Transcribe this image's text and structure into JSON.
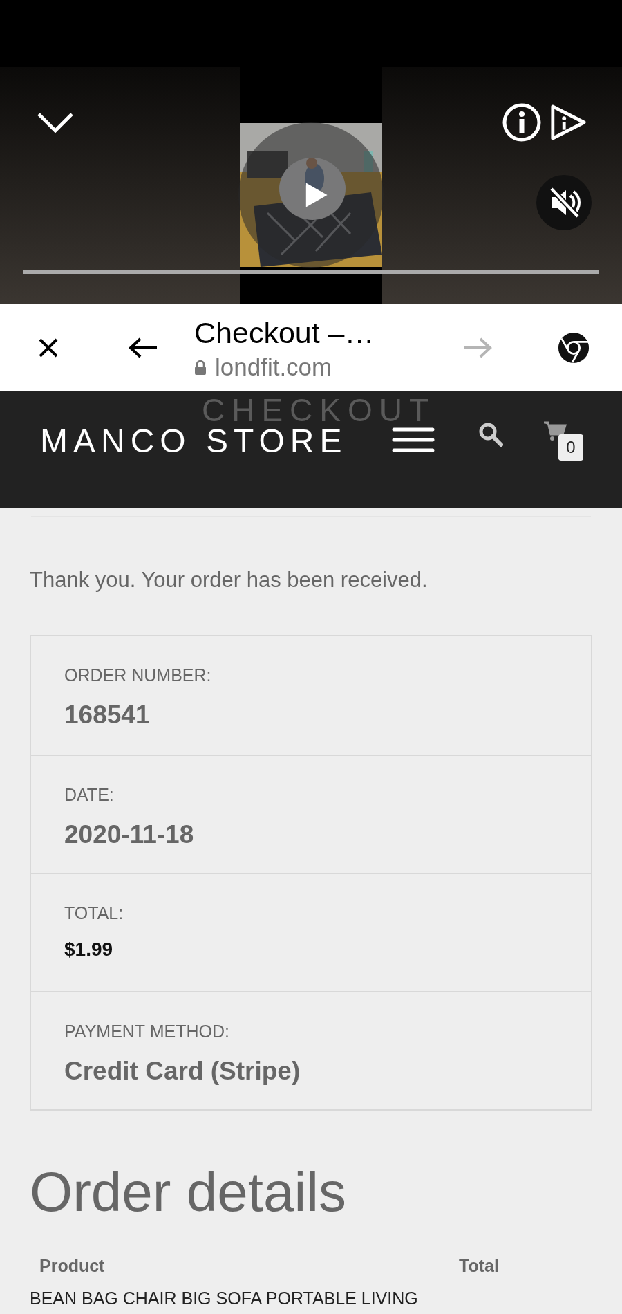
{
  "browser_bar": {
    "title": "Checkout –…",
    "url": "londfit.com",
    "secure": true,
    "forward_disabled": true
  },
  "store_header": {
    "page_title": "CHECKOUT",
    "brand": "MANCO STORE",
    "cart_count": "0"
  },
  "notice": "Thank you. Your order has been received.",
  "order_overview": [
    {
      "label": "ORDER NUMBER:",
      "value": "168541",
      "kind": "text"
    },
    {
      "label": "DATE:",
      "value": "2020-11-18",
      "kind": "text"
    },
    {
      "label": "TOTAL:",
      "value": "$1.99",
      "kind": "price"
    },
    {
      "label": "PAYMENT METHOD:",
      "value": "Credit Card (Stripe)",
      "kind": "text"
    }
  ],
  "order_details": {
    "heading": "Order details",
    "columns": [
      "Product",
      "Total"
    ],
    "rows": [
      {
        "product": "BEAN BAG CHAIR BIG SOFA PORTABLE LIVING"
      }
    ]
  }
}
